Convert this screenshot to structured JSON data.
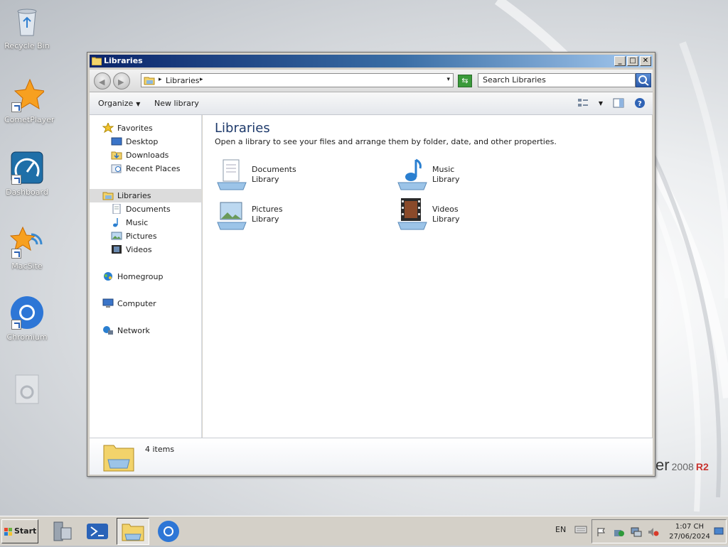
{
  "desktop": {
    "icons": [
      {
        "label": "Recycle Bin",
        "icon": "recycle-bin-icon"
      },
      {
        "label": "CometPlayer",
        "icon": "star-shortcut-icon"
      },
      {
        "label": "Dashboard",
        "icon": "dashboard-gauge-icon"
      },
      {
        "label": "MacSite",
        "icon": "star-wifi-shortcut-icon"
      },
      {
        "label": "Chromium",
        "icon": "chromium-icon"
      },
      {
        "label": "",
        "icon": "faded-app-icon"
      }
    ],
    "watermark": {
      "text": "er",
      "year": "2008",
      "edition": "R2"
    }
  },
  "window": {
    "title": "Libraries",
    "controls": {
      "minimize": "_",
      "maximize": "□",
      "close": "✕"
    },
    "address": {
      "crumb": "Libraries",
      "separator": "▸",
      "dropdown": "▾"
    },
    "search": {
      "placeholder": "Search Libraries"
    },
    "toolbar": {
      "organize": "Organize",
      "new_library": "New library",
      "caret": "▼"
    },
    "nav": {
      "favorites": {
        "label": "Favorites",
        "items": [
          "Desktop",
          "Downloads",
          "Recent Places"
        ]
      },
      "libraries": {
        "label": "Libraries",
        "items": [
          "Documents",
          "Music",
          "Pictures",
          "Videos"
        ]
      },
      "homegroup": "Homegroup",
      "computer": "Computer",
      "network": "Network"
    },
    "content": {
      "heading": "Libraries",
      "description": "Open a library to see your files and arrange them by folder, date, and other properties.",
      "libraries": [
        {
          "name": "Documents",
          "type": "Library",
          "icon": "documents-library-icon"
        },
        {
          "name": "Music",
          "type": "Library",
          "icon": "music-library-icon"
        },
        {
          "name": "Pictures",
          "type": "Library",
          "icon": "pictures-library-icon"
        },
        {
          "name": "Videos",
          "type": "Library",
          "icon": "videos-library-icon"
        }
      ]
    },
    "details": {
      "count": "4 items"
    }
  },
  "taskbar": {
    "start": "Start",
    "apps": [
      "server-manager-icon",
      "powershell-icon",
      "explorer-icon",
      "chromium-icon"
    ],
    "language": "EN",
    "clock": {
      "time": "1:07 CH",
      "date": "27/06/2024"
    }
  },
  "colors": {
    "title_start": "#0a246a",
    "title_end": "#a6caf0",
    "selection": "#dcdcdc",
    "heading": "#1e3a6b"
  }
}
